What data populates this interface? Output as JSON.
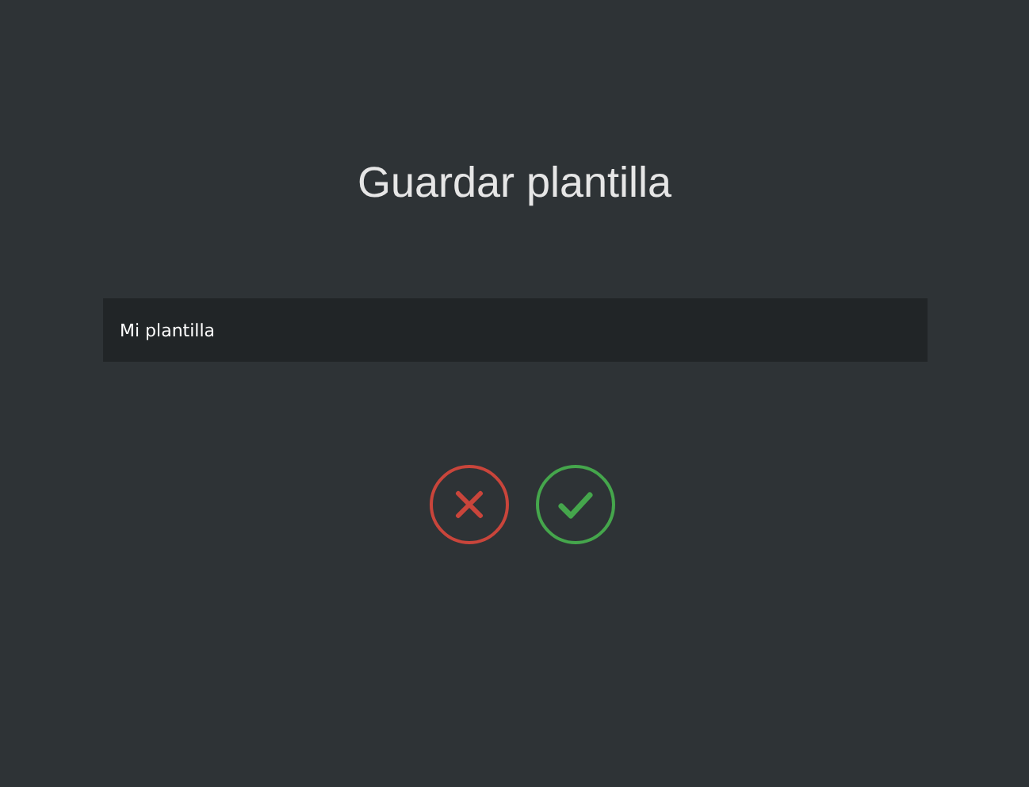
{
  "dialog": {
    "title": "Guardar plantilla",
    "name_field": {
      "value": "Mi plantilla"
    },
    "buttons": [
      {
        "kind": "cancel"
      },
      {
        "kind": "confirm"
      }
    ]
  }
}
